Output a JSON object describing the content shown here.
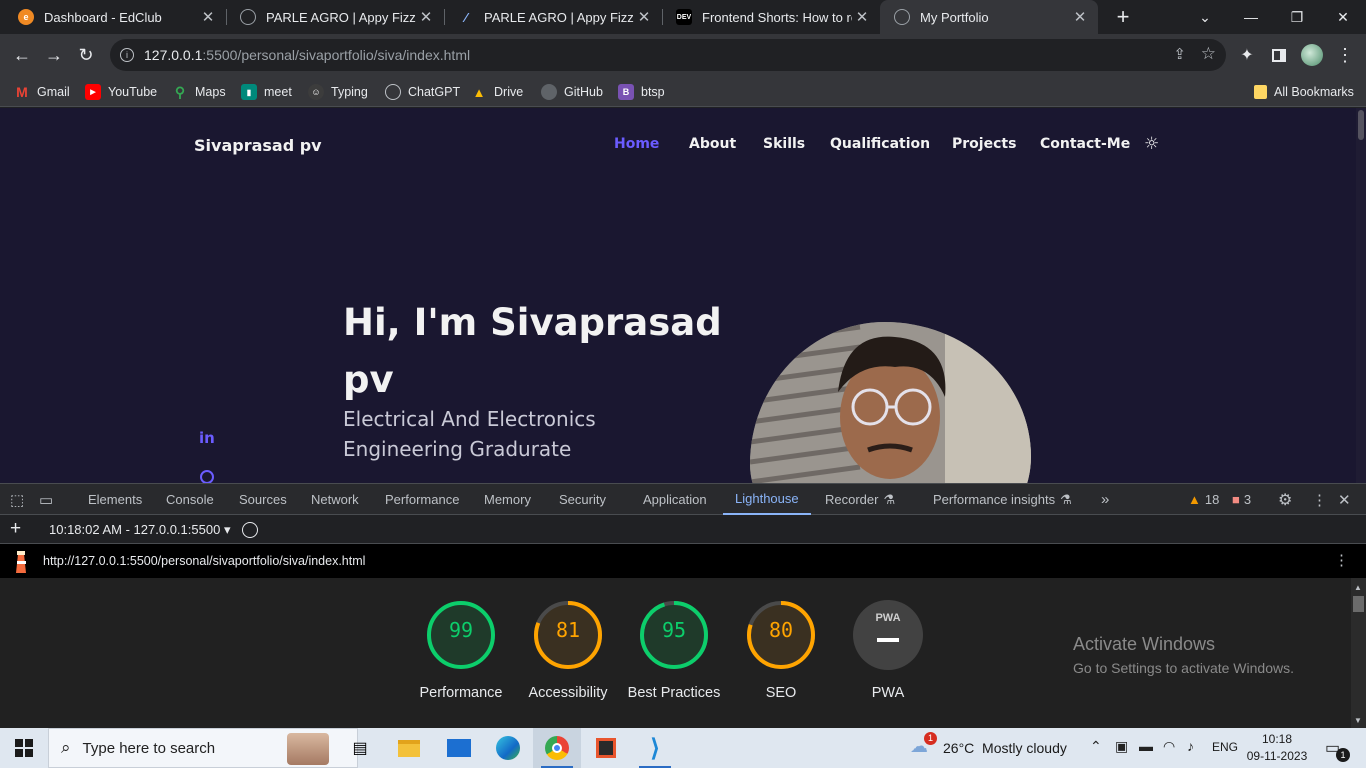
{
  "browser": {
    "tabs": [
      {
        "title": "Dashboard - EdClub",
        "icon": "edclub-icon",
        "color": "#f08a24"
      },
      {
        "title": "PARLE AGRO | Appy Fizz",
        "icon": "globe-icon",
        "color": "#5f6368"
      },
      {
        "title": "PARLE AGRO | Appy Fizz",
        "icon": "feather-icon",
        "color": "#1a1a3a"
      },
      {
        "title": "Frontend Shorts: How to rot",
        "icon": "dev-icon",
        "color": "#000000"
      },
      {
        "title": "My Portfolio",
        "icon": "globe-icon",
        "color": "#5f6368"
      }
    ],
    "new_tab": "+",
    "address": {
      "host": "127.0.0.1",
      "path": ":5500/personal/sivaportfolio/siva/index.html"
    },
    "bookmarks": [
      {
        "label": "Gmail",
        "icon": "gmail-icon",
        "color": "#ea4335"
      },
      {
        "label": "YouTube",
        "icon": "youtube-icon",
        "color": "#ff0000"
      },
      {
        "label": "Maps",
        "icon": "maps-icon",
        "color": "#34a853"
      },
      {
        "label": "meet",
        "icon": "meet-icon",
        "color": "#00897b"
      },
      {
        "label": "Typing",
        "icon": "typing-icon",
        "color": "#f4b400"
      },
      {
        "label": "ChatGPT",
        "icon": "chatgpt-icon",
        "color": "#10a37f"
      },
      {
        "label": "Drive",
        "icon": "drive-icon",
        "color": "#fbbc04"
      },
      {
        "label": "GitHub",
        "icon": "github-icon",
        "color": "#333333"
      },
      {
        "label": "btsp",
        "icon": "bootstrap-icon",
        "color": "#7952b3"
      }
    ],
    "all_bookmarks": "All Bookmarks"
  },
  "portfolio": {
    "brand": "Sivaprasad pv",
    "nav": [
      "Home",
      "About",
      "Skills",
      "Qualification",
      "Projects",
      "Contact-Me"
    ],
    "accent": "#6b5cff",
    "hero_title": "Hi, I'm Sivaprasad pv",
    "hero_subtitle": "Electrical And Electronics Engineering Gradurate"
  },
  "devtools": {
    "tabs": [
      "Elements",
      "Console",
      "Sources",
      "Network",
      "Performance",
      "Memory",
      "Security",
      "Application",
      "Lighthouse",
      "Recorder",
      "Performance insights"
    ],
    "active_tab": "Lighthouse",
    "warnings": "18",
    "errors": "3",
    "report_select": "10:18:02 AM - 127.0.0.1:5500",
    "report_url": "http://127.0.0.1:5500/personal/sivaportfolio/siva/index.html",
    "scores": [
      {
        "value": 99,
        "label": "Performance",
        "color": "#0cce6b"
      },
      {
        "value": 81,
        "label": "Accessibility",
        "color": "#ffa400"
      },
      {
        "value": 95,
        "label": "Best Practices",
        "color": "#0cce6b"
      },
      {
        "value": 80,
        "label": "SEO",
        "color": "#ffa400"
      }
    ],
    "pwa": {
      "badge": "PWA",
      "label": "PWA"
    },
    "activate_title": "Activate Windows",
    "activate_sub": "Go to Settings to activate Windows."
  },
  "taskbar": {
    "search_placeholder": "Type here to search",
    "weather": "26°C  Mostly cloudy",
    "weather_badge": "1",
    "lang": "ENG",
    "time": "10:18",
    "date": "09-11-2023",
    "notif": "1"
  }
}
